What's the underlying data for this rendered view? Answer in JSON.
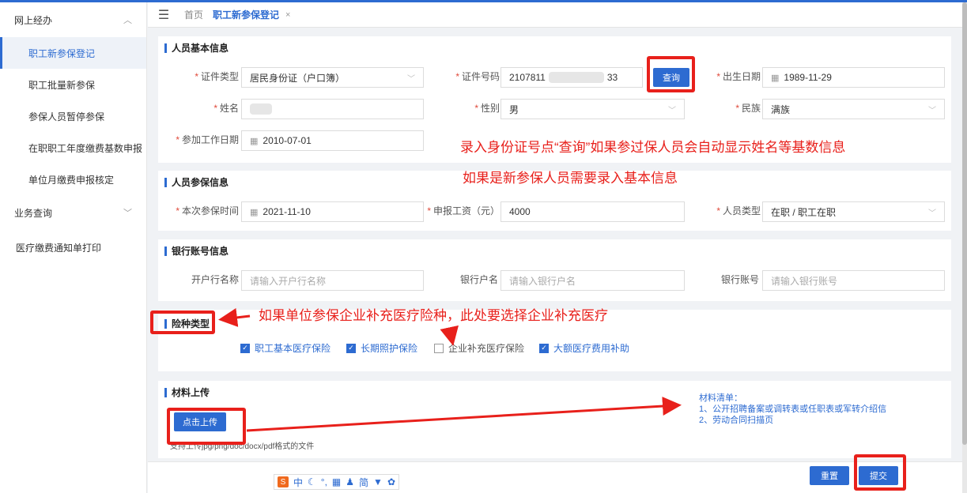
{
  "sidebar": {
    "group1": "网上经办",
    "items": [
      "职工新参保登记",
      "职工批量新参保",
      "参保人员暂停参保",
      "在职职工年度缴费基数申报",
      "单位月缴费申报核定"
    ],
    "group2": "业务查询",
    "plain": "医疗缴费通知单打印"
  },
  "tabs": {
    "home": "首页",
    "active": "职工新参保登记",
    "close": "×"
  },
  "basic": {
    "title": "人员基本信息",
    "id_type_label": "证件类型",
    "id_type_value": "居民身份证（户口簿）",
    "id_no_label": "证件号码",
    "id_no_value": "2107811",
    "id_no_tail": "33",
    "query_button": "查询",
    "birth_label": "出生日期",
    "birth_value": "1989-11-29",
    "name_label": "姓名",
    "gender_label": "性别",
    "gender_value": "男",
    "ethnic_label": "民族",
    "ethnic_value": "满族",
    "work_date_label": "参加工作日期",
    "work_date_value": "2010-07-01"
  },
  "insured": {
    "title": "人员参保信息",
    "time_label": "本次参保时间",
    "time_value": "2021-11-10",
    "wage_label": "申报工资（元）",
    "wage_value": "4000",
    "type_label": "人员类型",
    "type_value": "在职 / 职工在职"
  },
  "bank": {
    "title": "银行账号信息",
    "branch_label": "开户行名称",
    "branch_placeholder": "请输入开户行名称",
    "holder_label": "银行户名",
    "holder_placeholder": "请输入银行户名",
    "account_label": "银行账号",
    "account_placeholder": "请输入银行账号"
  },
  "insurance": {
    "title": "险种类型",
    "options": [
      {
        "label": "职工基本医疗保险",
        "checked": true
      },
      {
        "label": "长期照护保险",
        "checked": true
      },
      {
        "label": "企业补充医疗保险",
        "checked": false
      },
      {
        "label": "大额医疗费用补助",
        "checked": true
      }
    ]
  },
  "upload": {
    "title": "材料上传",
    "button": "点击上传",
    "hint": "支持上传jpg/png/doc/docx/pdf格式的文件",
    "materials_title": "材料清单：",
    "material_1": "1、公开招聘备案或调转表或任职表或军转介绍信",
    "material_2": "2、劳动合同扫描页"
  },
  "actions": {
    "reset": "重置",
    "submit": "提交"
  },
  "annotations": {
    "a1": "录入身份证号点“查询”如果参过保人员会自动显示姓名等基数信息",
    "a2": "如果是新参保人员需要录入基本信息",
    "a3": "如果单位参保企业补充医疗险种，此处要选择企业补充医疗"
  },
  "ime": {
    "chars": [
      "中",
      "简"
    ]
  },
  "colors": {
    "primary": "#2d6bd1",
    "annotation": "#e8201b",
    "required": "#e04a3b"
  }
}
